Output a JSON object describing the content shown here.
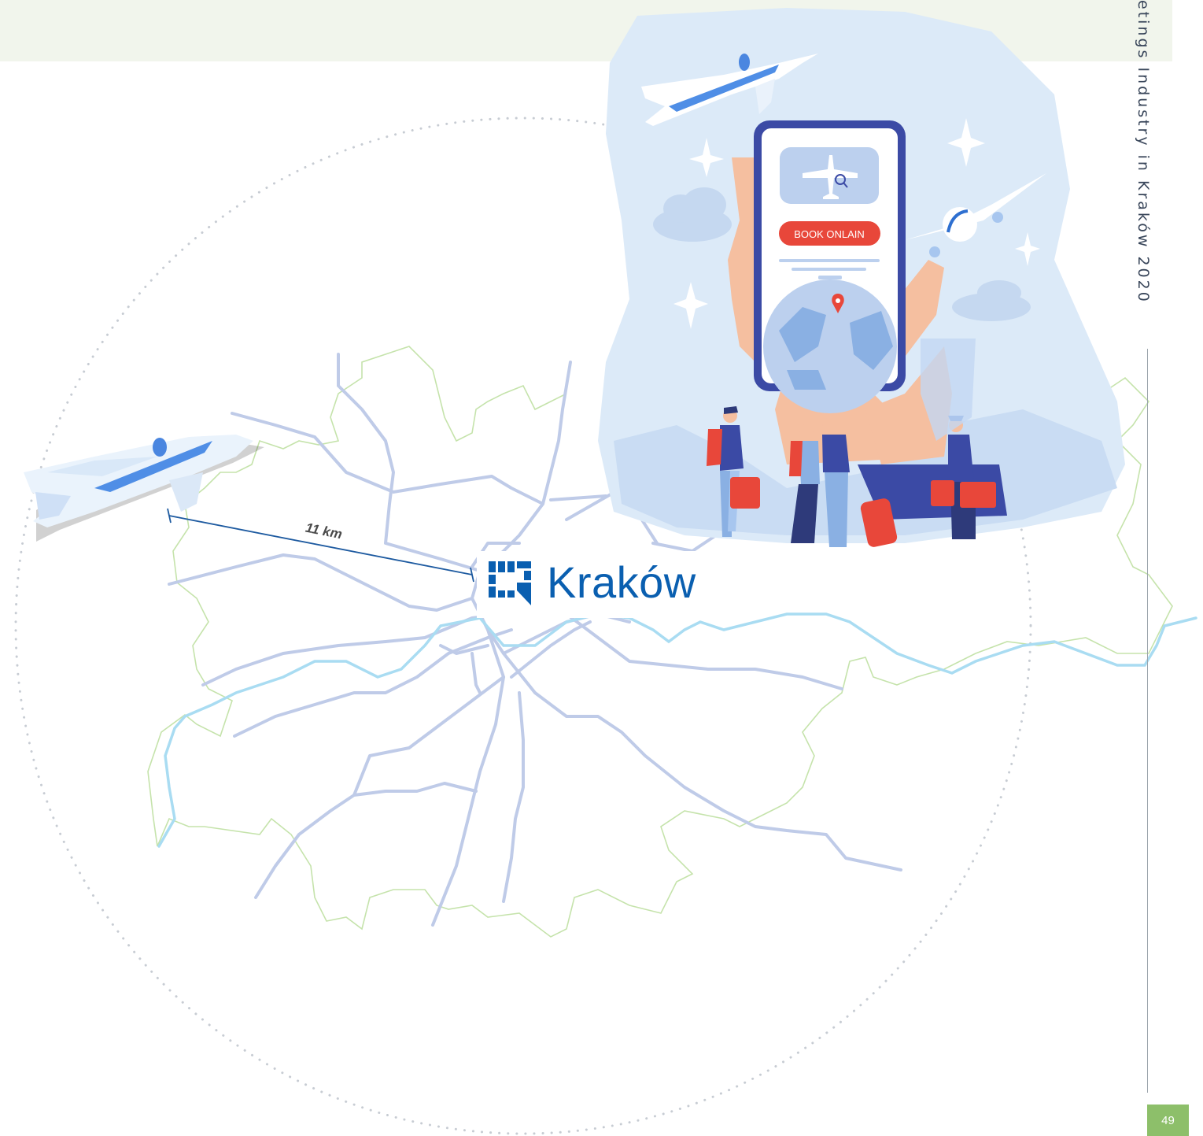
{
  "sidebar": {
    "title": "etings Industry in Kraków 2020"
  },
  "page": {
    "number": "49"
  },
  "map": {
    "city_name": "Kraków",
    "distance_label": "11 km",
    "colors": {
      "roads": "#bfcbe8",
      "river": "#a9dcf2",
      "border": "#c5e3ab",
      "brand": "#0a5fb0"
    }
  },
  "illustration": {
    "button_label": "BOOK ONLAIN",
    "icons": [
      "airplane-icon",
      "search-icon",
      "location-pin-icon",
      "globe-icon",
      "cloud-icon",
      "sparkle-icon",
      "suitcase-icon"
    ]
  }
}
